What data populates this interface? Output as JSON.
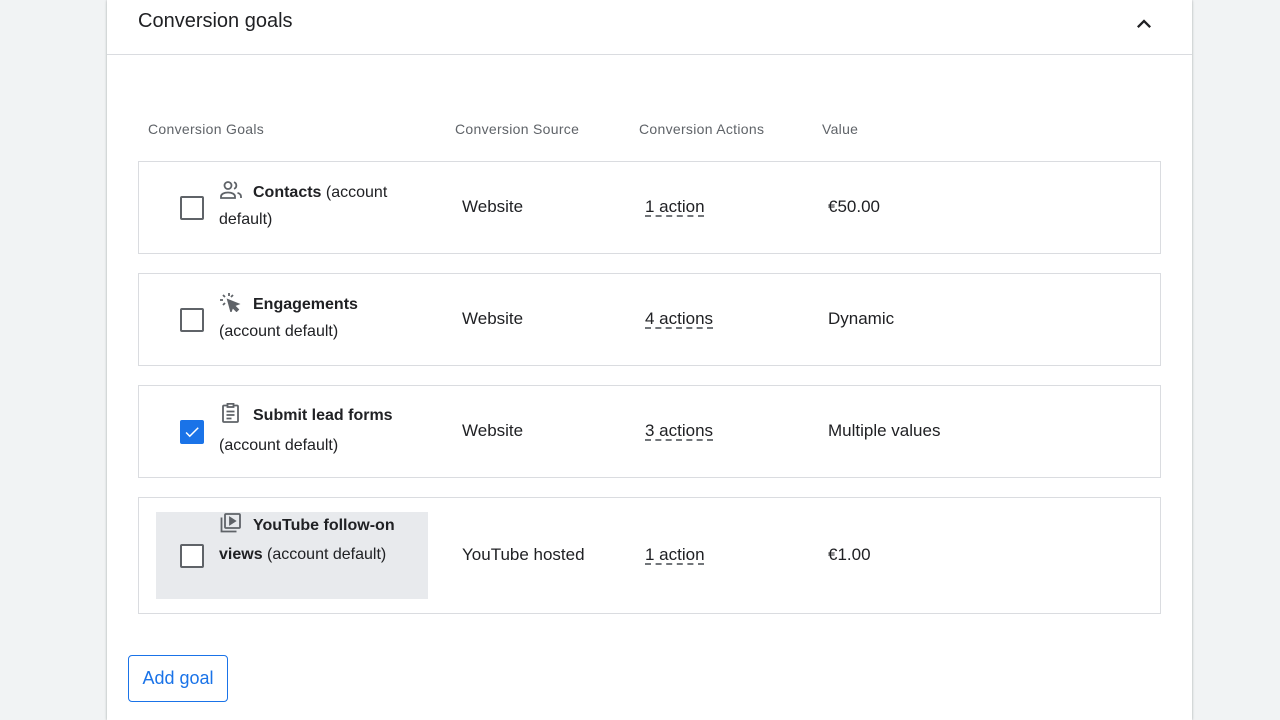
{
  "section": {
    "title": "Conversion goals"
  },
  "table": {
    "headers": [
      "Conversion Goals",
      "Conversion Source",
      "Conversion Actions",
      "Value"
    ],
    "rows": [
      {
        "icon": "people-icon",
        "name": "Contacts",
        "suffix": " (account default)",
        "checked": false,
        "source": "Website",
        "actions": "1 action",
        "value": "€50.00"
      },
      {
        "icon": "cursor-click-icon",
        "name": "Engagements",
        "suffix": " (account default)",
        "checked": false,
        "source": "Website",
        "actions": "4 actions",
        "value": "Dynamic"
      },
      {
        "icon": "clipboard-form-icon",
        "name": "Submit lead forms",
        "suffix": " (account default)",
        "checked": true,
        "source": "Website",
        "actions": "3 actions",
        "value": "Multiple values"
      },
      {
        "icon": "video-library-icon",
        "name": "YouTube follow-on views",
        "suffix": " (account default)",
        "checked": false,
        "source": "YouTube hosted",
        "actions": "1 action",
        "value": "€1.00"
      }
    ]
  },
  "add_goal_label": "Add goal",
  "colors": {
    "accent": "#1a73e8",
    "hover_row": "#e8eaed",
    "border": "#dadce0"
  }
}
